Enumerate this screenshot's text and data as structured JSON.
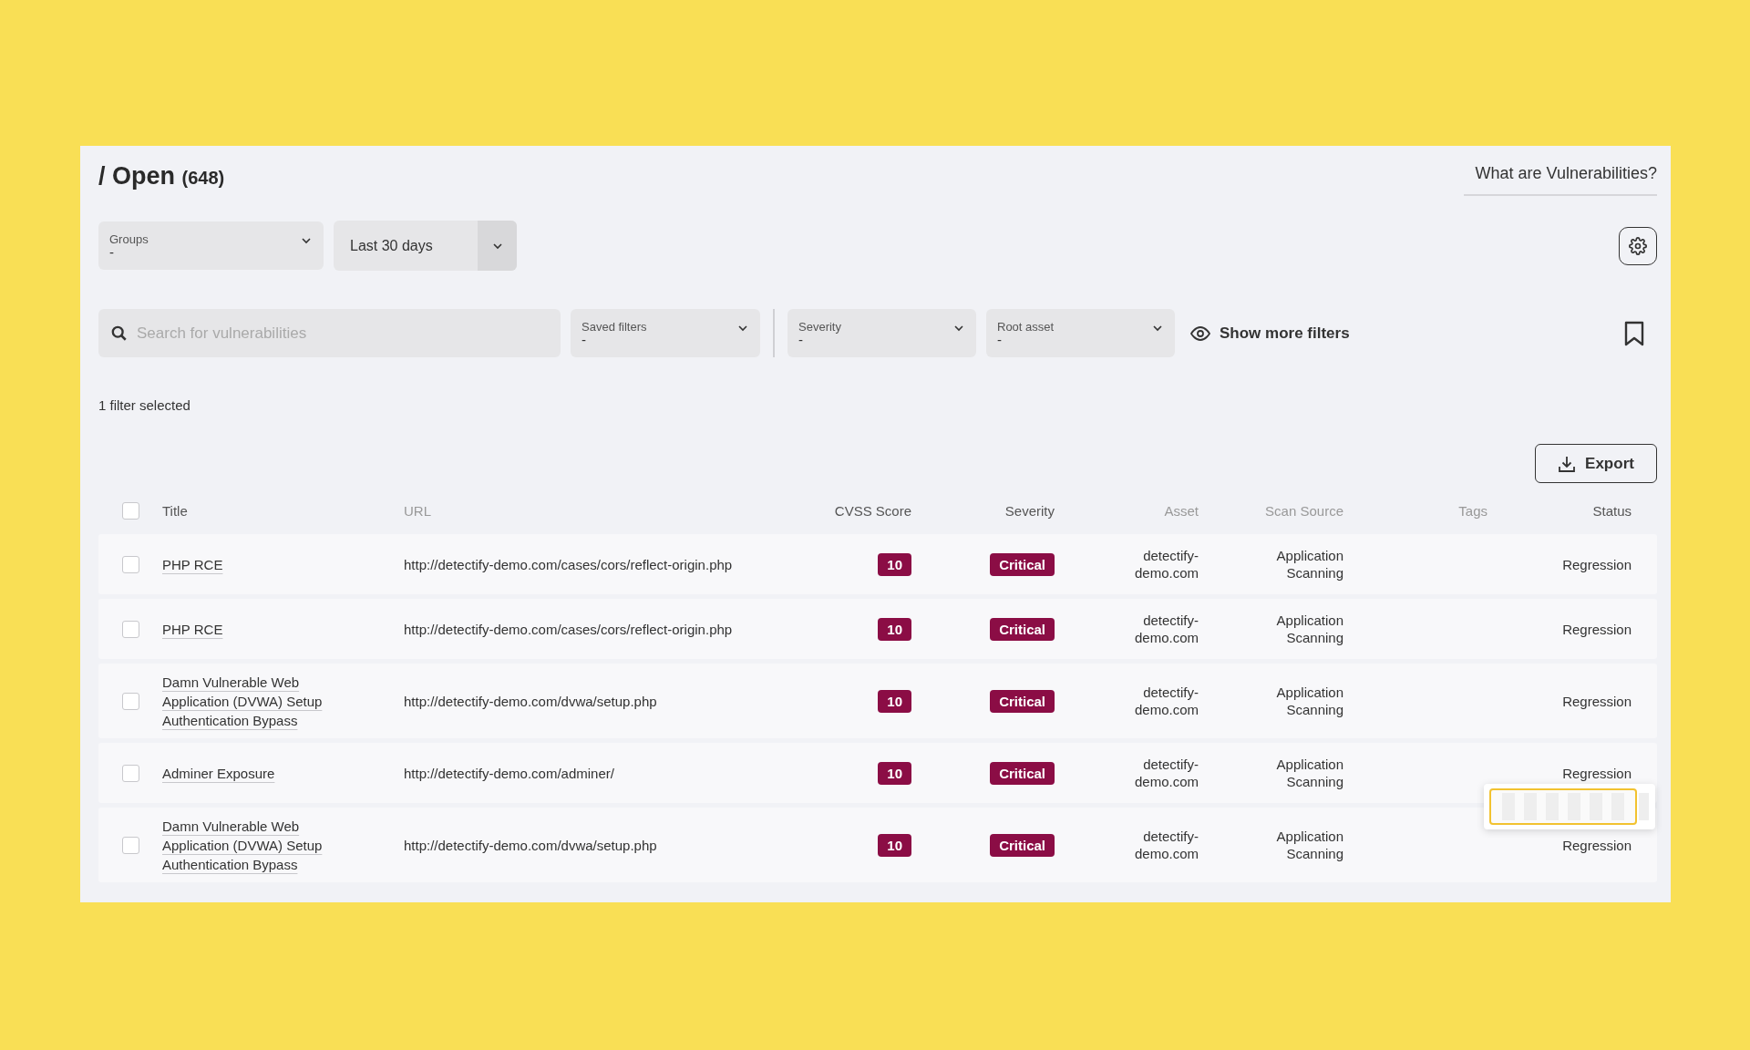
{
  "header": {
    "breadcrumb": "/ Open",
    "count": "(648)",
    "help_link": "What are Vulnerabilities?"
  },
  "top_filters": [
    {
      "kind": "select",
      "label": "Groups",
      "value": "-"
    },
    {
      "kind": "split",
      "value": "Last 30 days"
    }
  ],
  "search": {
    "placeholder": "Search for vulnerabilities"
  },
  "filters": [
    {
      "label": "Saved filters",
      "value": "-"
    },
    {
      "label": "Severity",
      "value": "-"
    },
    {
      "label": "Root asset",
      "value": "-"
    }
  ],
  "show_more_filters": "Show more filters",
  "filter_summary": "1 filter selected",
  "export_button": "Export",
  "table": {
    "select_all_checked": false,
    "columns": [
      {
        "label": "Title",
        "sortable": true
      },
      {
        "label": "URL",
        "sortable": false
      },
      {
        "label": "CVSS Score",
        "sortable": true
      },
      {
        "label": "Severity",
        "sortable": true
      },
      {
        "label": "Asset",
        "sortable": false
      },
      {
        "label": "Scan Source",
        "sortable": false
      },
      {
        "label": "Tags",
        "sortable": false
      },
      {
        "label": "Status",
        "sortable": true
      }
    ],
    "rows": [
      {
        "checked": false,
        "title": "PHP RCE",
        "url": "http://detectify-demo.com/cases/cors/reflect-origin.php",
        "cvss": "10",
        "severity": "Critical",
        "asset": "detectify-demo.com",
        "scan_source": "Application Scanning",
        "status": "Regression"
      },
      {
        "checked": false,
        "title": "PHP RCE",
        "url": "http://detectify-demo.com/cases/cors/reflect-origin.php",
        "cvss": "10",
        "severity": "Critical",
        "asset": "detectify-demo.com",
        "scan_source": "Application Scanning",
        "status": "Regression"
      },
      {
        "checked": false,
        "title": "Damn Vulnerable Web Application (DVWA) Setup Authentication Bypass",
        "url": "http://detectify-demo.com/dvwa/setup.php",
        "cvss": "10",
        "severity": "Critical",
        "asset": "detectify-demo.com",
        "scan_source": "Application Scanning",
        "status": "Regression"
      },
      {
        "checked": false,
        "title": "Adminer Exposure",
        "url": "http://detectify-demo.com/adminer/",
        "cvss": "10",
        "severity": "Critical",
        "asset": "detectify-demo.com",
        "scan_source": "Application Scanning",
        "status": "Regression"
      },
      {
        "checked": false,
        "title": "Damn Vulnerable Web Application (DVWA) Setup Authentication Bypass",
        "url": "http://detectify-demo.com/dvwa/setup.php",
        "cvss": "10",
        "severity": "Critical",
        "asset": "detectify-demo.com",
        "scan_source": "Application Scanning",
        "status": "Regression"
      }
    ]
  }
}
